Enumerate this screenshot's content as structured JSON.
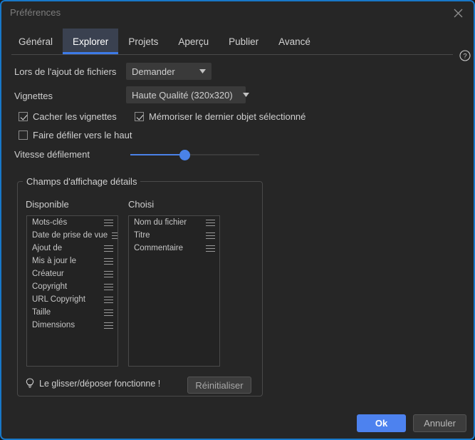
{
  "window": {
    "title": "Préférences",
    "close_icon": "close-icon",
    "accent_border": "#1878c8",
    "background": "#262626"
  },
  "tabs": {
    "items": [
      {
        "label": "Général",
        "active": false
      },
      {
        "label": "Explorer",
        "active": true
      },
      {
        "label": "Projets",
        "active": false
      },
      {
        "label": "Aperçu",
        "active": false
      },
      {
        "label": "Publier",
        "active": false
      },
      {
        "label": "Avancé",
        "active": false
      }
    ],
    "active_color": "#3d7ae8",
    "help_icon": "help-circle-icon"
  },
  "settings": {
    "add_files": {
      "label": "Lors de l'ajout de fichiers",
      "value": "Demander",
      "options": [
        "Demander"
      ]
    },
    "thumbnails": {
      "label": "Vignettes",
      "value": "Haute Qualité (320x320)",
      "options": [
        "Haute Qualité (320x320)"
      ]
    },
    "checkboxes": [
      {
        "label": "Cacher les vignettes",
        "checked": true
      },
      {
        "label": "Mémoriser le dernier objet sélectionné",
        "checked": true
      },
      {
        "label": "Faire défiler vers le haut",
        "checked": false
      }
    ],
    "scroll_speed": {
      "label": "Vitesse défilement",
      "value": 43,
      "min": 0,
      "max": 100,
      "accent": "#4a82e8"
    }
  },
  "details_group": {
    "title": "Champs d'affichage détails",
    "available": {
      "header": "Disponible",
      "items": [
        "Mots-clés",
        "Date de prise de vue",
        "Ajout de",
        "Mis à jour le",
        "Créateur",
        "Copyright",
        "URL Copyright",
        "Taille",
        "Dimensions"
      ]
    },
    "chosen": {
      "header": "Choisi",
      "items": [
        "Nom du fichier",
        "Titre",
        "Commentaire"
      ]
    },
    "hint": {
      "icon": "lightbulb-icon",
      "text": "Le glisser/déposer fonctionne !"
    },
    "reset_label": "Réinitialiser"
  },
  "footer": {
    "ok_label": "Ok",
    "cancel_label": "Annuler",
    "ok_color": "#4d82ef"
  }
}
